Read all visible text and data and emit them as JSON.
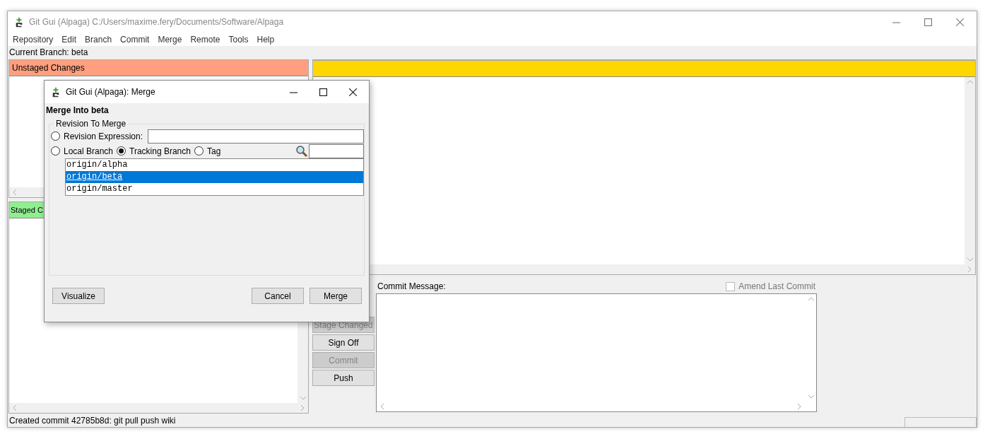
{
  "window": {
    "title": "Git Gui (Alpaga) C:/Users/maxime.fery/Documents/Software/Alpaga"
  },
  "menu": [
    "Repository",
    "Edit",
    "Branch",
    "Commit",
    "Merge",
    "Remote",
    "Tools",
    "Help"
  ],
  "current_branch": "Current Branch: beta",
  "unstaged": {
    "title": "Unstaged Changes"
  },
  "staged": {
    "title": "Staged C"
  },
  "actions": [
    {
      "label": "Stage Changed",
      "disabled": true
    },
    {
      "label": "Sign Off",
      "disabled": false
    },
    {
      "label": "Commit",
      "disabled": true
    },
    {
      "label": "Push",
      "disabled": false
    }
  ],
  "commit_message": {
    "label": "Commit Message:"
  },
  "amend": {
    "label": "Amend Last Commit",
    "checked": false,
    "disabled": true
  },
  "status_bar": {
    "text": "Created commit 42785b8d: git pull push wiki"
  },
  "dialog": {
    "title": "Git Gui (Alpaga): Merge",
    "heading": "Merge Into beta",
    "group": "Revision To Merge",
    "sources": [
      {
        "kind": "expression",
        "label": "Revision Expression:",
        "selected": false
      },
      {
        "kind": "branch",
        "label": "Local Branch",
        "selected": false
      },
      {
        "kind": "branch",
        "label": "Tracking Branch",
        "selected": true
      },
      {
        "kind": "branch",
        "label": "Tag",
        "selected": false
      }
    ],
    "branches": [
      {
        "name": "origin/alpha",
        "selected": false
      },
      {
        "name": "origin/beta",
        "selected": true
      },
      {
        "name": "origin/master",
        "selected": false
      }
    ],
    "buttons": [
      {
        "kind": "visualize",
        "label": "Visualize"
      },
      {
        "kind": "cancel",
        "label": "Cancel"
      },
      {
        "kind": "merge",
        "label": "Merge"
      }
    ]
  }
}
